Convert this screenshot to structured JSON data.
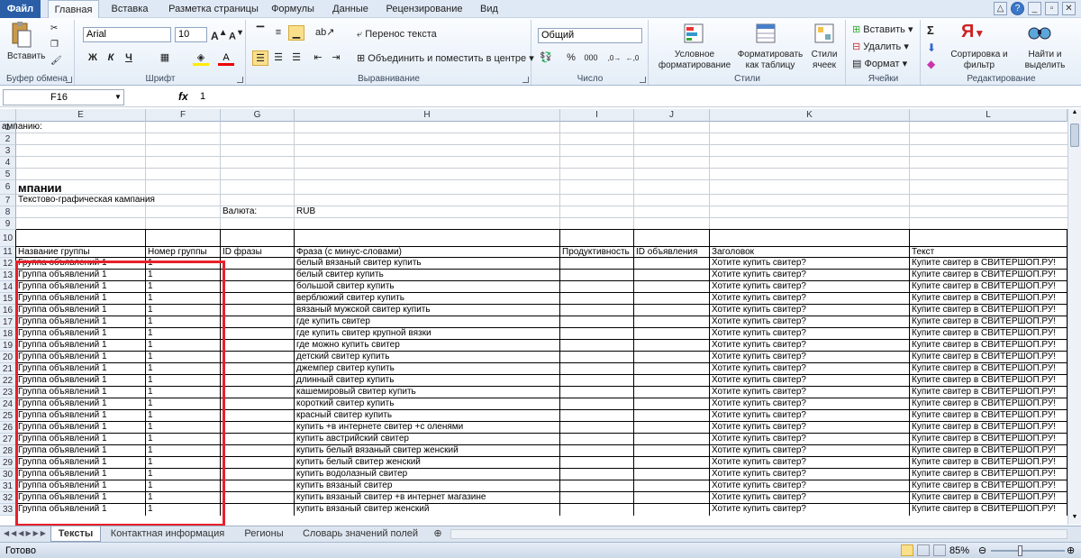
{
  "ribbon_tabs": [
    "Файл",
    "Главная",
    "Вставка",
    "Разметка страницы",
    "Формулы",
    "Данные",
    "Рецензирование",
    "Вид"
  ],
  "groups": {
    "clipboard": {
      "label": "Буфер обмена",
      "paste": "Вставить"
    },
    "font": {
      "label": "Шрифт",
      "font_name": "Arial",
      "font_size": "10",
      "bold": "Ж",
      "italic": "К",
      "underline": "Ч"
    },
    "alignment": {
      "label": "Выравнивание",
      "wrap": "Перенос текста",
      "merge": "Объединить и поместить в центре"
    },
    "number": {
      "label": "Число",
      "format": "Общий",
      "percent": "%",
      "thousands": "000"
    },
    "styles": {
      "label": "Стили",
      "conditional": "Условное форматирование",
      "as_table": "Форматировать как таблицу",
      "cell_styles": "Стили ячеек"
    },
    "cells": {
      "label": "Ячейки",
      "insert": "Вставить",
      "delete": "Удалить",
      "format": "Формат"
    },
    "editing": {
      "label": "Редактирование",
      "sort": "Сортировка и фильтр",
      "find": "Найти и выделить",
      "sigma": "Σ"
    }
  },
  "formula_bar": {
    "name_box": "F16",
    "fx": "fx",
    "value": "1"
  },
  "columns": [
    "E",
    "F",
    "G",
    "H",
    "I",
    "J",
    "K",
    "L"
  ],
  "sheet": {
    "title": "мпании",
    "campaign_type": "Текстово-графическая кампания",
    "currency_label": "Валюта:",
    "currency_value": "RUB",
    "row9_text": "ампанию:",
    "headers": [
      "Название группы",
      "Номер группы",
      "ID фразы",
      "Фраза (с минус-словами)",
      "Продуктивность",
      "ID объявления",
      "Заголовок",
      "Текст"
    ],
    "group_name": "Группа объявлений 1",
    "group_number": "1",
    "ad_title": "Хотите купить свитер?",
    "ad_text": "Купите свитер в СВИТЕРШОП.РУ!",
    "phrases": [
      "белый вязаный свитер купить",
      "белый свитер купить",
      "большой свитер купить",
      "верблюжий свитер купить",
      "вязаный мужской свитер купить",
      "где купить свитер",
      "где купить свитер крупной вязки",
      "где можно купить свитер",
      "детский свитер купить",
      "джемпер свитер купить",
      "длинный свитер купить",
      "кашемировый свитер купить",
      "короткий свитер купить",
      "красный свитер купить",
      "купить +в интернете свитер +с оленями",
      "купить австрийский свитер",
      "купить белый вязаный свитер женский",
      "купить белый свитер женский",
      "купить водолазный свитер",
      "купить вязаный свитер",
      "купить вязаный свитер +в интернет магазине",
      "купить вязаный свитер женский"
    ]
  },
  "sheet_tabs": [
    "Тексты",
    "Контактная информация",
    "Регионы",
    "Словарь значений полей"
  ],
  "status": {
    "ready": "Готово",
    "zoom": "85%"
  },
  "colors": {
    "accent": "#2a5fa8",
    "highlight": "#e8202a"
  }
}
